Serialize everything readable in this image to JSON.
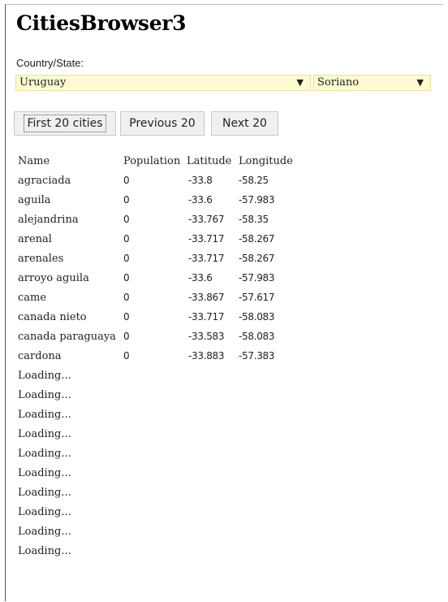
{
  "app": {
    "title": "CitiesBrowser3"
  },
  "filters": {
    "country_label": "Country/State:",
    "country_value": "Uruguay",
    "state_value": "Soriano"
  },
  "buttons": {
    "first": "First 20 cities",
    "previous": "Previous 20",
    "next": "Next 20"
  },
  "table": {
    "headers": [
      "Name",
      "Population",
      "Latitude",
      "Longitude"
    ],
    "rows": [
      [
        "agraciada",
        "0",
        "-33.8",
        "-58.25"
      ],
      [
        "aguila",
        "0",
        "-33.6",
        "-57.983"
      ],
      [
        "alejandrina",
        "0",
        "-33.767",
        "-58.35"
      ],
      [
        "arenal",
        "0",
        "-33.717",
        "-58.267"
      ],
      [
        "arenales",
        "0",
        "-33.717",
        "-58.267"
      ],
      [
        "arroyo aguila",
        "0",
        "-33.6",
        "-57.983"
      ],
      [
        "came",
        "0",
        "-33.867",
        "-57.617"
      ],
      [
        "canada nieto",
        "0",
        "-33.717",
        "-58.083"
      ],
      [
        "canada paraguaya",
        "0",
        "-33.583",
        "-58.083"
      ],
      [
        "cardona",
        "0",
        "-33.883",
        "-57.383"
      ]
    ],
    "loading": [
      "Loading...",
      "Loading...",
      "Loading...",
      "Loading...",
      "Loading...",
      "Loading...",
      "Loading...",
      "Loading...",
      "Loading...",
      "Loading..."
    ]
  },
  "icons": {
    "dropdown": "chevron-down-icon"
  }
}
